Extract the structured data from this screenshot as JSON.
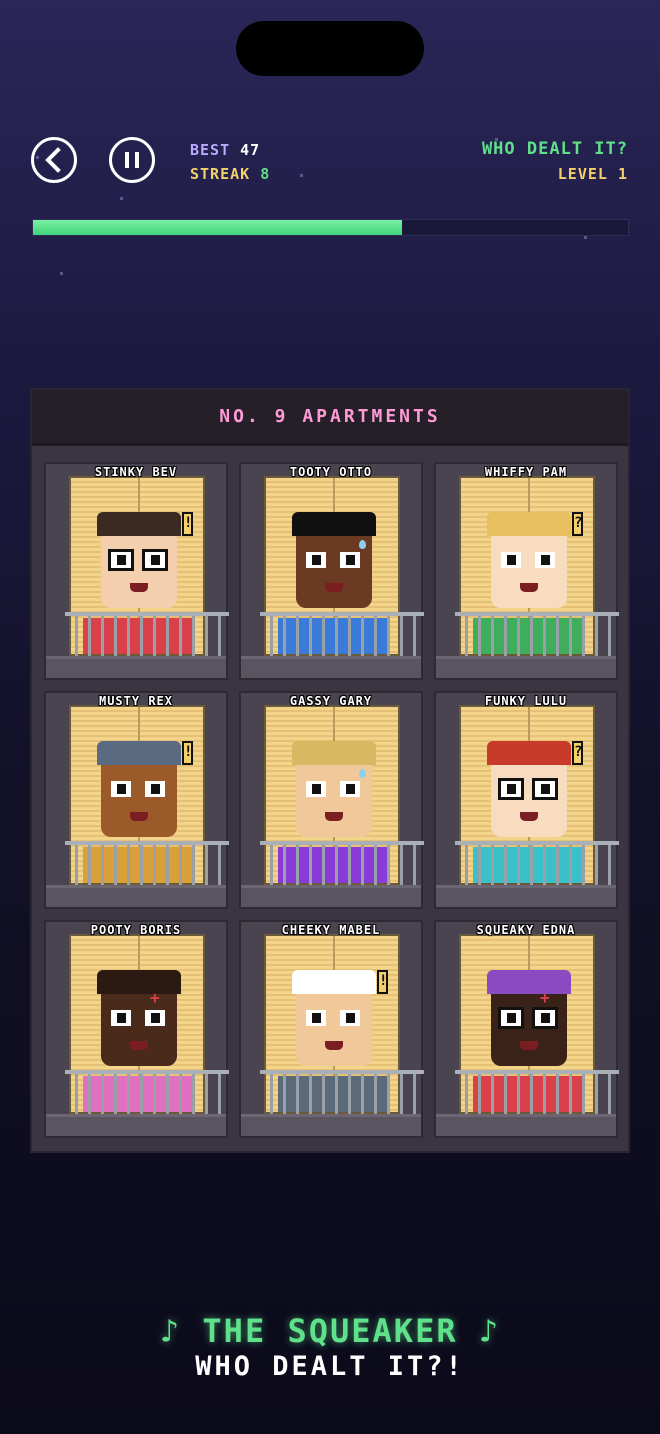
{
  "hud": {
    "best_label": "BEST",
    "best_value": "47",
    "streak_label": "STREAK",
    "streak_value": "8",
    "game_title": "WHO DEALT IT?",
    "level_label": "LEVEL",
    "level_value": "1",
    "progress": 0.62
  },
  "building": {
    "sign": "NO. 9 APARTMENTS",
    "tenants": [
      {
        "name": "STINKY BEV",
        "skin": "#f4cfae",
        "hair": "#3a2a22",
        "shirt": "#d9404a",
        "glasses": true,
        "marker": "!"
      },
      {
        "name": "TOOTY OTTO",
        "skin": "#6b3a22",
        "hair": "#111111",
        "shirt": "#3a7ad9",
        "glasses": false,
        "marker": "drop"
      },
      {
        "name": "WHIFFY PAM",
        "skin": "#f8dcc0",
        "hair": "#e8c060",
        "shirt": "#3fae5c",
        "glasses": false,
        "marker": "?"
      },
      {
        "name": "MUSTY REX",
        "skin": "#9a5a2a",
        "hair": "#5a6a80",
        "shirt": "#d9a03a",
        "glasses": false,
        "marker": "!"
      },
      {
        "name": "GASSY GARY",
        "skin": "#f0c89a",
        "hair": "#d8b860",
        "shirt": "#8a3ad9",
        "glasses": false,
        "marker": "drop"
      },
      {
        "name": "FUNKY LULU",
        "skin": "#f8dcc0",
        "hair": "#c83a2a",
        "shirt": "#3ac0c8",
        "glasses": true,
        "marker": "?"
      },
      {
        "name": "POOTY BORIS",
        "skin": "#4a2a1a",
        "hair": "#2a1a12",
        "shirt": "#e070c0",
        "glasses": false,
        "marker": "+"
      },
      {
        "name": "CHEEKY MABEL",
        "skin": "#f0c89a",
        "hair": "#ffffff",
        "shirt": "#5a6a78",
        "glasses": false,
        "marker": "!"
      },
      {
        "name": "SQUEAKY EDNA",
        "skin": "#3a2218",
        "hair": "#8a4ac0",
        "shirt": "#d9404a",
        "glasses": true,
        "marker": "+"
      }
    ]
  },
  "footer": {
    "title": "♪ THE SQUEAKER ♪",
    "subtitle": "WHO DEALT IT?!"
  },
  "icons": {
    "back": "back-arrow-icon",
    "pause": "pause-icon"
  }
}
